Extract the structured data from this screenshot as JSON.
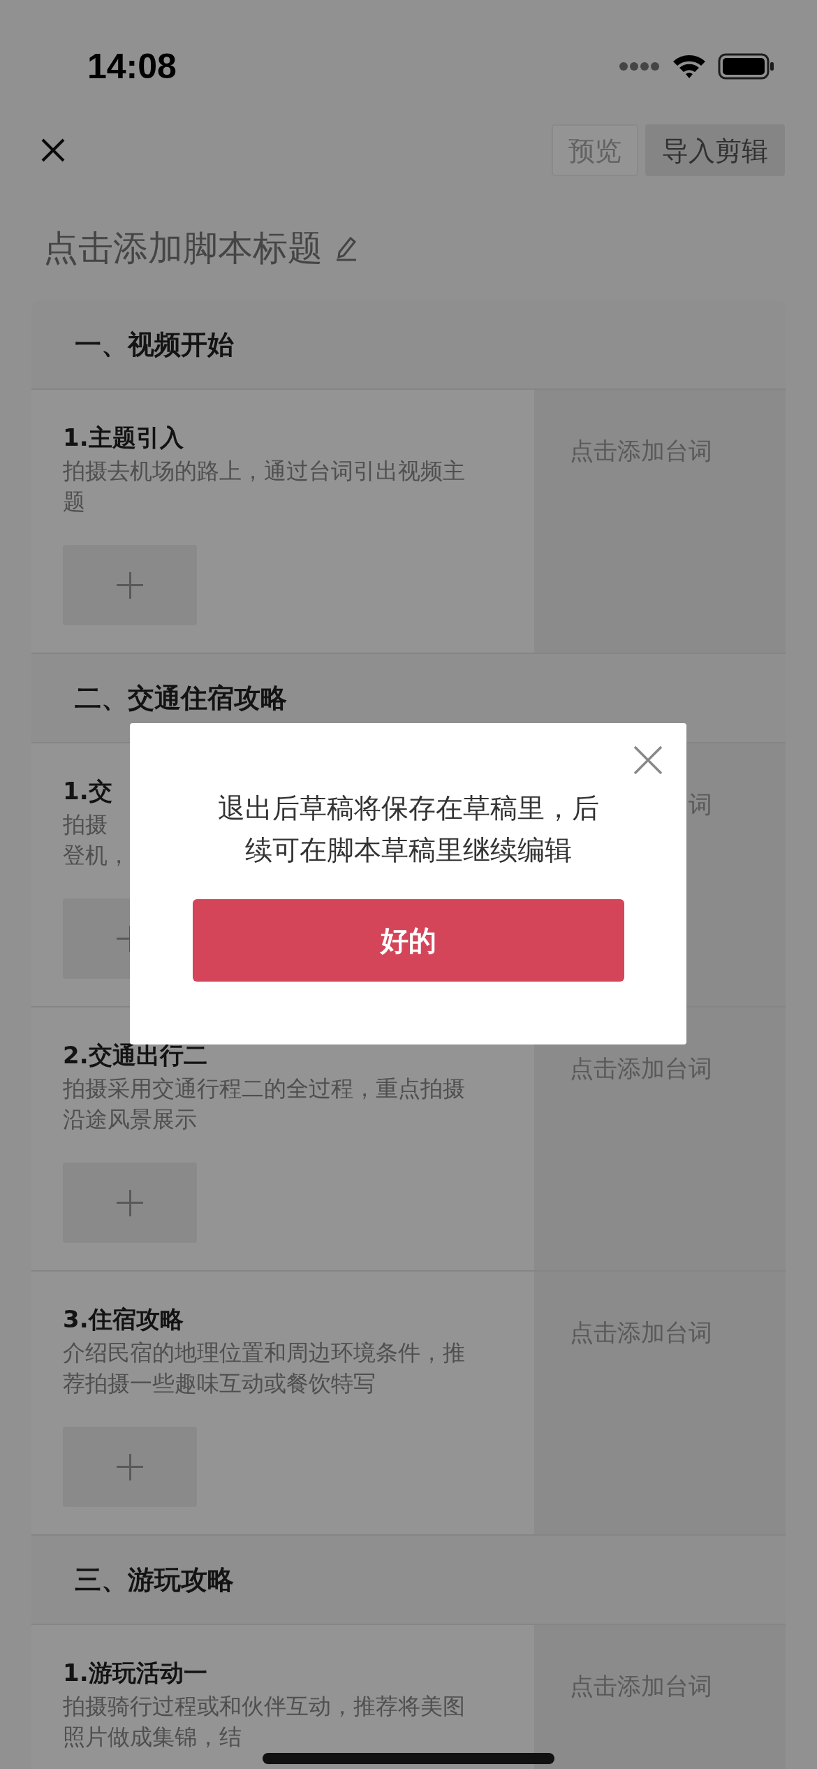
{
  "status_bar": {
    "time": "14:08"
  },
  "header": {
    "buttons": [
      {
        "label": "预览",
        "kind": "outline"
      },
      {
        "label": "导入剪辑",
        "kind": "filled"
      }
    ]
  },
  "script_title": "点击添加脚本标题",
  "sections": [
    {
      "title": "一、视频开始",
      "rows": [
        {
          "title": "1.主题引入",
          "desc_lines": [
            "拍摄去机场的路上，通过台词引出视频主",
            "题"
          ],
          "script": "点击添加台词",
          "add_tile": true
        }
      ]
    },
    {
      "title": "二、交通住宿攻略",
      "rows": [
        {
          "title": "1.交",
          "desc_lines": [
            "拍摄",
            "登机，"
          ],
          "script": "词",
          "add_tile": true
        },
        {
          "title": "2.交通出行二",
          "desc_lines": [
            "拍摄采用交通行程二的全过程，重点拍摄",
            "沿途风景展示"
          ],
          "script": "点击添加台词",
          "add_tile": true
        },
        {
          "title": "3.住宿攻略",
          "desc_lines": [
            "介绍民宿的地理位置和周边环境条件，推",
            "荐拍摄一些趣味互动或餐饮特写"
          ],
          "script": "点击添加台词",
          "add_tile": true
        }
      ]
    },
    {
      "title": "三、游玩攻略",
      "rows": [
        {
          "title": "1.游玩活动一",
          "desc_lines": [
            "拍摄骑行过程或和伙伴互动，推荐将美图",
            "照片做成集锦，结"
          ],
          "script": "点击添加台词",
          "add_tile": false
        }
      ]
    }
  ],
  "dialog": {
    "message": "退出后草稿将保存在草稿里，后续可在脚本草稿里继续编辑",
    "button": "好的"
  }
}
